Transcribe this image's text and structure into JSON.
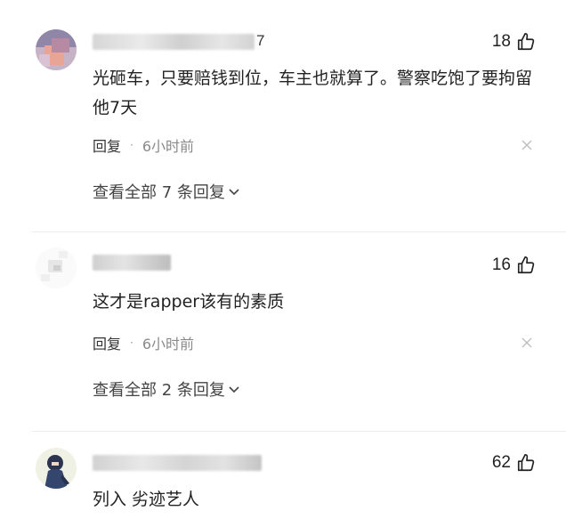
{
  "comments": [
    {
      "username_tail": "7",
      "likes": "18",
      "text": "光砸车，只要赔钱到位，车主也就算了。警察吃饱了要拘留他7天",
      "reply_label": "回复",
      "separator": "·",
      "time": "6小时前",
      "more_replies": "查看全部 7 条回复"
    },
    {
      "username_tail": "",
      "likes": "16",
      "text": "这才是rapper该有的素质",
      "reply_label": "回复",
      "separator": "·",
      "time": "6小时前",
      "more_replies": "查看全部 2 条回复"
    },
    {
      "username_tail": "",
      "likes": "62",
      "text": "列入 劣迹艺人"
    }
  ],
  "icons": {
    "like": "thumbs-up-icon",
    "close": "close-icon",
    "expand": "chevron-down-icon"
  },
  "colors": {
    "text": "#222222",
    "meta": "#8a8a8a",
    "divider": "#ececec"
  }
}
